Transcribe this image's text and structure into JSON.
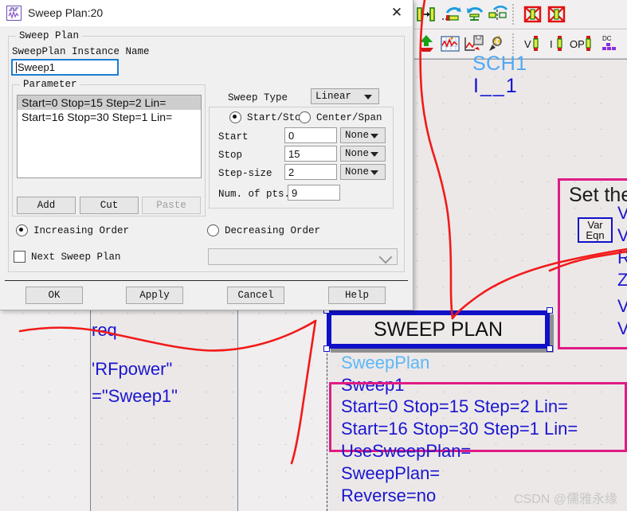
{
  "dialog": {
    "title": "Sweep Plan:20",
    "title_icon": "sweep-waveform-icon",
    "close_label": "✕",
    "group_sweep_plan": "Sweep Plan",
    "instance_name_label": "SweepPlan Instance Name",
    "instance_name_value": "Sweep1",
    "group_parameter": "Parameter",
    "parameter_items": [
      "Start=0 Stop=15 Step=2 Lin=",
      "Start=16 Stop=30 Step=1 Lin="
    ],
    "parameter_selected_index": 0,
    "buttons_param": {
      "add": "Add",
      "cut": "Cut",
      "paste": "Paste"
    },
    "sweep_type_label": "Sweep Type",
    "sweep_type_value": "Linear",
    "mode_start_stop": "Start/Stop",
    "mode_center_span": "Center/Span",
    "mode_selected": "Start/Stop",
    "fields": [
      {
        "label": "Start",
        "value": "0",
        "unit": "None"
      },
      {
        "label": "Stop",
        "value": "15",
        "unit": "None"
      },
      {
        "label": "Step-size",
        "value": "2",
        "unit": "None"
      }
    ],
    "num_pts_label": "Num. of pts.",
    "num_pts_value": "9",
    "order_increasing": "Increasing Order",
    "order_decreasing": "Decreasing Order",
    "order_selected": "Increasing Order",
    "next_sweep_plan_label": "Next Sweep Plan",
    "next_sweep_plan_checked": false,
    "next_sweep_plan_value": "",
    "buttons_footer": {
      "ok": "OK",
      "apply": "Apply",
      "cancel": "Cancel",
      "help": "Help"
    }
  },
  "toolbar": {
    "row1": [
      "insert-pin-icon",
      "wire-label-icon",
      "swap-component-icon",
      "mirror-component-icon",
      "deactivate-component-icon",
      "deactivate-all-icon"
    ],
    "row2": [
      "push-into-hierarchy-icon",
      "display-data-icon",
      "tune-parameters-icon",
      "optimization-wizard-icon",
      "v-probe-icon",
      "i-probe-icon",
      "op-probe-icon",
      "dc-block-icon"
    ]
  },
  "canvas": {
    "sch_label": "SCH1",
    "instance_label": "I__1",
    "left_text": {
      "req": "req",
      "rfpower": "'RFpower\"",
      "sweep_assign": "=\"Sweep1\""
    },
    "sweep_plan_component": {
      "title": "SWEEP PLAN",
      "type": "SweepPlan",
      "name": "Sweep1",
      "params": [
        "Start=0 Stop=15 Step=2 Lin=",
        "Start=16 Stop=30 Step=1 Lin=",
        "UseSweepPlan=",
        "SweepPlan=",
        "Reverse=no"
      ]
    },
    "right_panel": {
      "heading": "Set the",
      "var_eqn_line1": "Var",
      "var_eqn_line2": "Eqn",
      "clipped_lines": [
        "V",
        "V",
        "R",
        "Z",
        "V",
        "V"
      ]
    },
    "watermark": "CSDN @儒雅永缘"
  },
  "colors": {
    "accent_blue": "#1010c8",
    "light_blue": "#4ea8f7",
    "pink": "#e01b84",
    "ink_red": "#f21a1a",
    "selection_gray": "#cecece",
    "focus_blue": "#1b7fd4"
  }
}
